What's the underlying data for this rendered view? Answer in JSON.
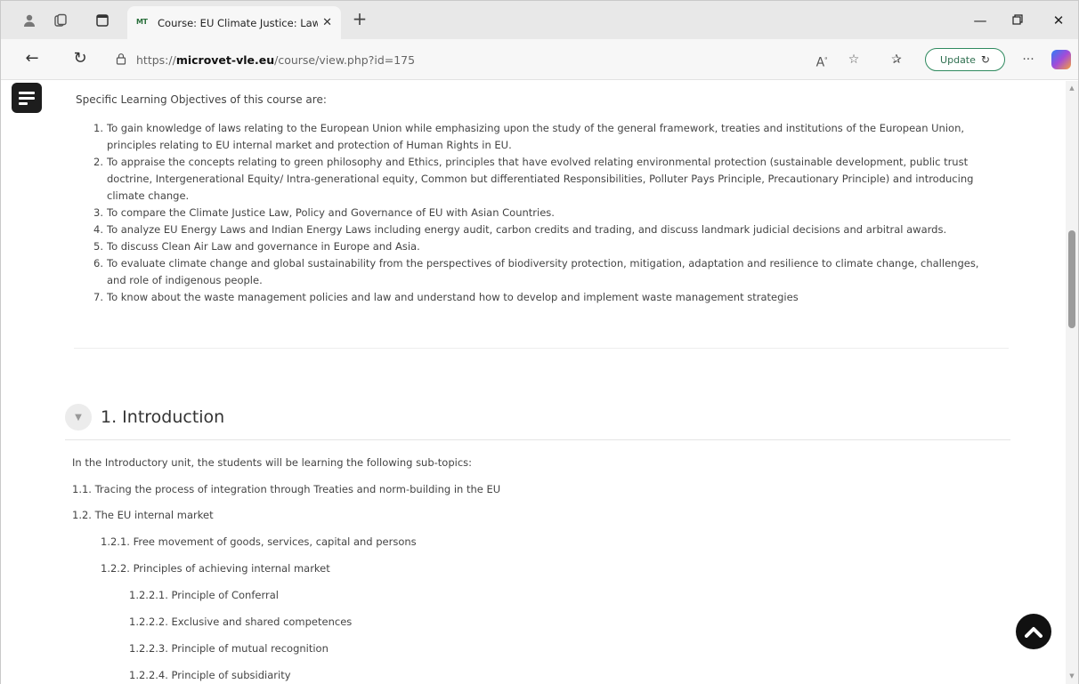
{
  "browser": {
    "tab_title": "Course: EU Climate Justice: Law, C",
    "tab_favicon_text": "MT",
    "url_prefix": "https://",
    "url_domain": "microvet-vle.eu",
    "url_path": "/course/view.php?id=175",
    "update_label": "Update"
  },
  "objectives": {
    "intro": "Specific Learning Objectives of this course are:",
    "items": [
      {
        "num": "1.",
        "text": "To gain knowledge of laws relating to the European Union while emphasizing upon the study of the general framework, treaties and institutions of the European Union, principles relating to EU internal market and protection of Human Rights in EU."
      },
      {
        "num": "2.",
        "text": "To appraise the concepts relating to green philosophy and Ethics, principles that have evolved relating environmental protection (sustainable development, public trust doctrine, Intergenerational Equity/ Intra-generational equity, Common but differentiated Responsibilities, Polluter Pays Principle, Precautionary Principle) and introducing climate change."
      },
      {
        "num": "3.",
        "text": "To compare the Climate Justice Law, Policy and Governance of EU with Asian Countries."
      },
      {
        "num": "4.",
        "text": "To analyze EU Energy Laws and Indian Energy Laws including energy audit, carbon credits and trading, and discuss landmark judicial decisions and arbitral awards."
      },
      {
        "num": "5.",
        "text": "To discuss Clean Air Law and governance in Europe and Asia."
      },
      {
        "num": "6.",
        "text": "To evaluate climate change and global sustainability from the perspectives of biodiversity protection, mitigation, adaptation and resilience to climate change, challenges, and role of indigenous people."
      },
      {
        "num": "7.",
        "text": "To know about the waste management policies and law and understand how to develop and implement waste management strategies"
      }
    ]
  },
  "section": {
    "title": "1. Introduction",
    "intro": "In the Introductory unit, the students will be learning the following sub-topics:",
    "topics": [
      "1.1. Tracing the process of integration through Treaties and norm-building in the EU",
      "1.2. The EU internal market",
      "1.2.1. Free movement of goods, services, capital and persons",
      "1.2.2. Principles of achieving internal market",
      "1.2.2.1. Principle of Conferral",
      "1.2.2.2. Exclusive and shared competences",
      "1.2.2.3. Principle of mutual recognition",
      "1.2.2.4. Principle of subsidiarity"
    ]
  }
}
